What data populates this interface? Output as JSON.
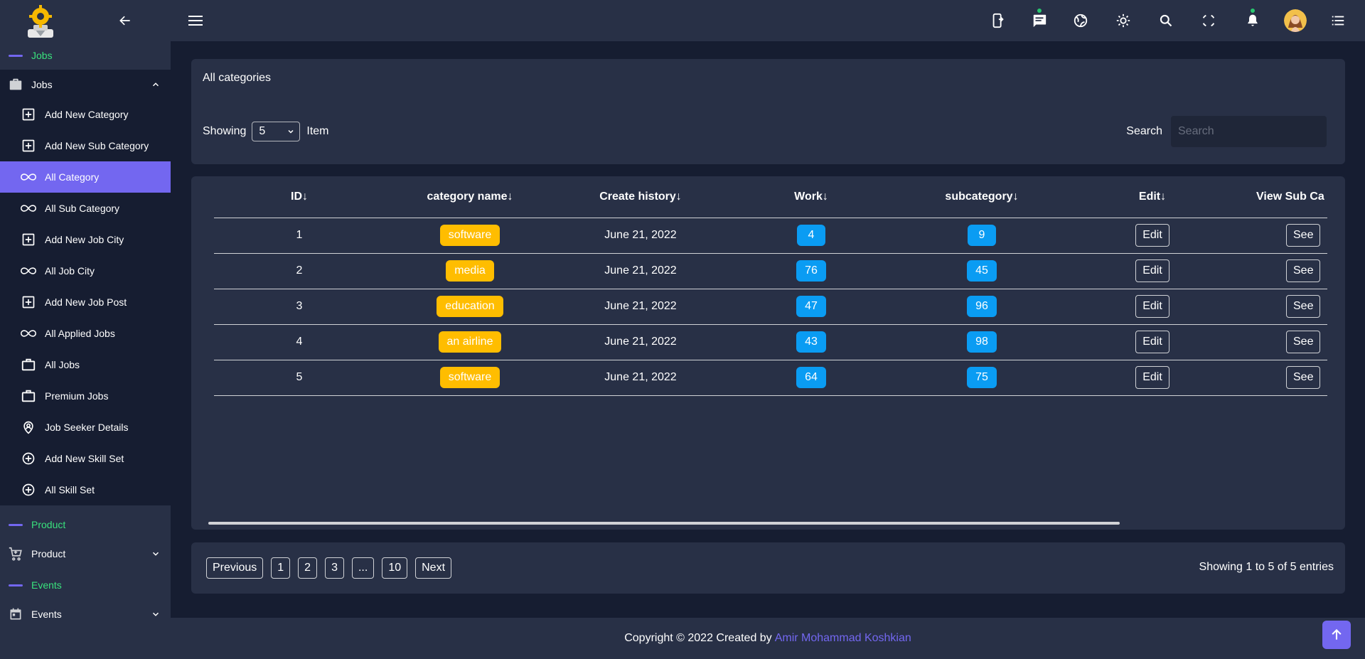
{
  "sidebar": {
    "sections": {
      "jobs": {
        "title": "Jobs",
        "menu_label": "Jobs",
        "items": [
          {
            "label": "Add New Category",
            "icon": "plus-square-icon"
          },
          {
            "label": "Add New Sub Category",
            "icon": "plus-square-icon"
          },
          {
            "label": "All Category",
            "icon": "infinity-icon",
            "active": true
          },
          {
            "label": "All Sub Category",
            "icon": "infinity-icon"
          },
          {
            "label": "Add New Job City",
            "icon": "plus-square-icon"
          },
          {
            "label": "All Job City",
            "icon": "infinity-icon"
          },
          {
            "label": "Add New Job Post",
            "icon": "plus-square-icon"
          },
          {
            "label": "All Applied Jobs",
            "icon": "infinity-icon"
          },
          {
            "label": "All Jobs",
            "icon": "briefcase-icon"
          },
          {
            "label": "Premium Jobs",
            "icon": "briefcase-icon"
          },
          {
            "label": "Job Seeker Details",
            "icon": "user-pin-icon"
          },
          {
            "label": "Add New Skill Set",
            "icon": "plus-circle-icon"
          },
          {
            "label": "All Skill Set",
            "icon": "plus-circle-icon"
          }
        ]
      },
      "product": {
        "title": "Product",
        "menu_label": "Product"
      },
      "events": {
        "title": "Events",
        "menu_label": "Events"
      }
    }
  },
  "page": {
    "title": "All categories",
    "showing_label": "Showing",
    "page_size": "5",
    "item_label": "Item",
    "search_label": "Search",
    "search_placeholder": "Search"
  },
  "table": {
    "headers": [
      "ID↓",
      "category name↓",
      "Create history↓",
      "Work↓",
      "subcategory↓",
      "Edit↓",
      "View Sub Ca"
    ],
    "edit_label": "Edit",
    "view_label": "See",
    "rows": [
      {
        "id": "1",
        "name": "software",
        "date": "June 21, 2022",
        "work": "4",
        "sub": "9"
      },
      {
        "id": "2",
        "name": "media",
        "date": "June 21, 2022",
        "work": "76",
        "sub": "45"
      },
      {
        "id": "3",
        "name": "education",
        "date": "June 21, 2022",
        "work": "47",
        "sub": "96"
      },
      {
        "id": "4",
        "name": "an airline",
        "date": "June 21, 2022",
        "work": "43",
        "sub": "98"
      },
      {
        "id": "5",
        "name": "software",
        "date": "June 21, 2022",
        "work": "64",
        "sub": "75"
      }
    ]
  },
  "pagination": {
    "previous": "Previous",
    "pages": [
      "1",
      "2",
      "3",
      "...",
      "10"
    ],
    "next": "Next",
    "info": "Showing 1 to 5 of 5 entries"
  },
  "footer": {
    "text": "Copyright © 2022 Created by",
    "author": "Amir Mohammad Koshkian"
  },
  "colors": {
    "accent": "#7367f0",
    "section_title": "#39e27d",
    "badge_yellow": "#ffbd00",
    "badge_blue": "#0a9cf3"
  }
}
